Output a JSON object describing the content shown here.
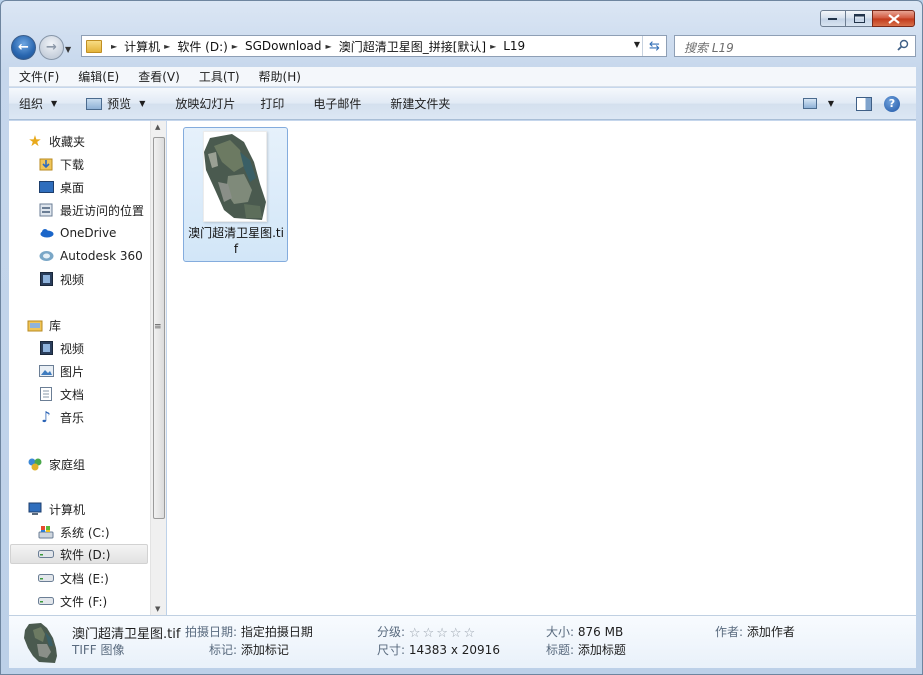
{
  "window": {
    "caption": {
      "minimize": "—",
      "maximize": "□",
      "close": "✕"
    }
  },
  "address": {
    "crumbs": [
      "计算机",
      "软件 (D:)",
      "SGDownload",
      "澳门超清卫星图_拼接[默认]",
      "L19"
    ]
  },
  "search": {
    "placeholder": "搜索 L19"
  },
  "menu": [
    "文件(F)",
    "编辑(E)",
    "查看(V)",
    "工具(T)",
    "帮助(H)"
  ],
  "toolbar": {
    "organize": "组织",
    "preview": "预览",
    "slideshow": "放映幻灯片",
    "print": "打印",
    "email": "电子邮件",
    "new_folder": "新建文件夹"
  },
  "sidebar": {
    "favorites_header": "收藏夹",
    "favorites": [
      "下载",
      "桌面",
      "最近访问的位置",
      "OneDrive",
      "Autodesk 360",
      "视频"
    ],
    "libraries_header": "库",
    "libraries": [
      "视频",
      "图片",
      "文档",
      "音乐"
    ],
    "homegroup": "家庭组",
    "computer_header": "计算机",
    "drives": [
      "系统 (C:)",
      "软件 (D:)",
      "文档 (E:)",
      "文件 (F:)"
    ],
    "selected_drive": "软件 (D:)"
  },
  "files": [
    {
      "name": "澳门超清卫星图.tif"
    }
  ],
  "details": {
    "filename": "澳门超清卫星图.tif",
    "filetype": "TIFF 图像",
    "date_label": "拍摄日期:",
    "date_value": "指定拍摄日期",
    "tags_label": "标记:",
    "tags_value": "添加标记",
    "rating_label": "分级:",
    "rating": 0,
    "dims_label": "尺寸:",
    "dims_value": "14383 x 20916",
    "size_label": "大小:",
    "size_value": "876 MB",
    "title_label": "标题:",
    "title_value": "添加标题",
    "author_label": "作者:",
    "author_value": "添加作者"
  }
}
